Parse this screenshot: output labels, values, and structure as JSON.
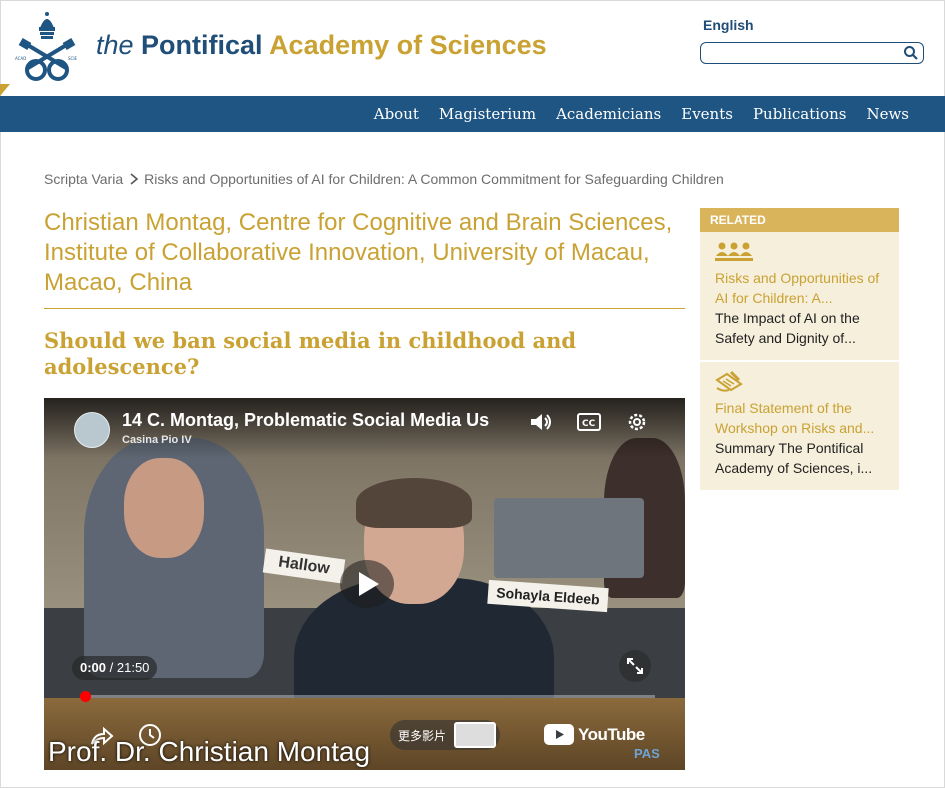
{
  "header": {
    "title_part1": "the ",
    "title_part2": "Pontifical ",
    "title_part3": "Academy of Sciences",
    "language": "English",
    "search_placeholder": "",
    "logo_text": "PONTIFICIA ACADEMIA SCIENTIARVM"
  },
  "nav": {
    "items": [
      "About",
      "Magisterium",
      "Academicians",
      "Events",
      "Publications",
      "News"
    ]
  },
  "breadcrumb": {
    "items": [
      "Scripta Varia",
      "Risks and Opportunities of AI for Children: A Common Commitment for Safeguarding Children"
    ]
  },
  "article": {
    "author": "Christian Montag, Centre for Cognitive and Brain Sciences, Institute of Collaborative Innovation, University of Macau, Macao, China",
    "title": "Should we ban social media in childhood and adolescence?"
  },
  "video": {
    "title": "14 C. Montag, Problematic Social Media Us",
    "channel": "Casina Pio IV",
    "time_current": "0:00",
    "time_total": " / 21:50",
    "more_videos_label": "更多影片",
    "youtube_label": "YouTube",
    "caption": "Prof. Dr. Christian Montag",
    "watermark": "PAS",
    "progress": 0.0,
    "scene_signs": [
      "Sohayla Eldeeb",
      "Hallow"
    ]
  },
  "related": {
    "header": "RELATED",
    "items": [
      {
        "icon": "people-group-icon",
        "title": "Risks and Opportunities of AI for Children: A...",
        "desc": "The Impact of AI on the Safety and Dignity of..."
      },
      {
        "icon": "document-pen-icon",
        "title": "Final Statement of the Workshop on Risks and...",
        "desc": "Summary The Pontifical Academy of Sciences, i..."
      }
    ]
  },
  "colors": {
    "brand_blue": "#1f5582",
    "brand_gold": "#c9a233",
    "related_header": "#d9b45a",
    "related_bg": "#f6efdc"
  }
}
